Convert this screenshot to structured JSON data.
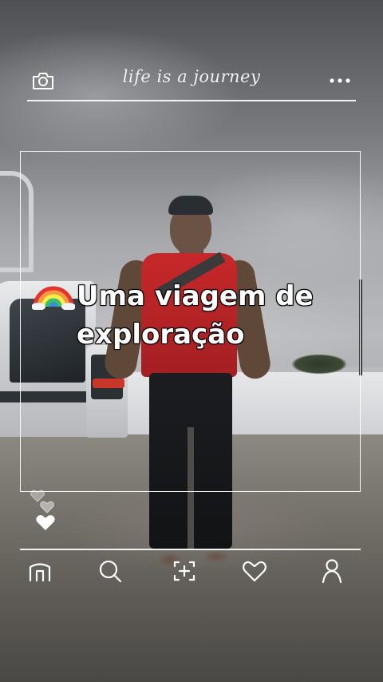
{
  "header": {
    "tagline": "life is a journey",
    "camera_icon": "camera-icon",
    "more_icon": "more-dots-icon"
  },
  "post": {
    "caption_emoji": "rainbow-icon",
    "caption_line1": "Uma viagem de",
    "caption_line2": "exploração"
  },
  "reactions": {
    "icons": [
      "heart-outline-icon",
      "heart-outline-icon",
      "heart-filled-icon"
    ]
  },
  "bottom_nav": {
    "items": [
      {
        "icon": "home-icon"
      },
      {
        "icon": "search-icon"
      },
      {
        "icon": "add-post-icon"
      },
      {
        "icon": "heart-icon"
      },
      {
        "icon": "profile-icon"
      }
    ]
  },
  "colors": {
    "overlay_line": "#ffffff",
    "caption_text": "#ffffff"
  }
}
